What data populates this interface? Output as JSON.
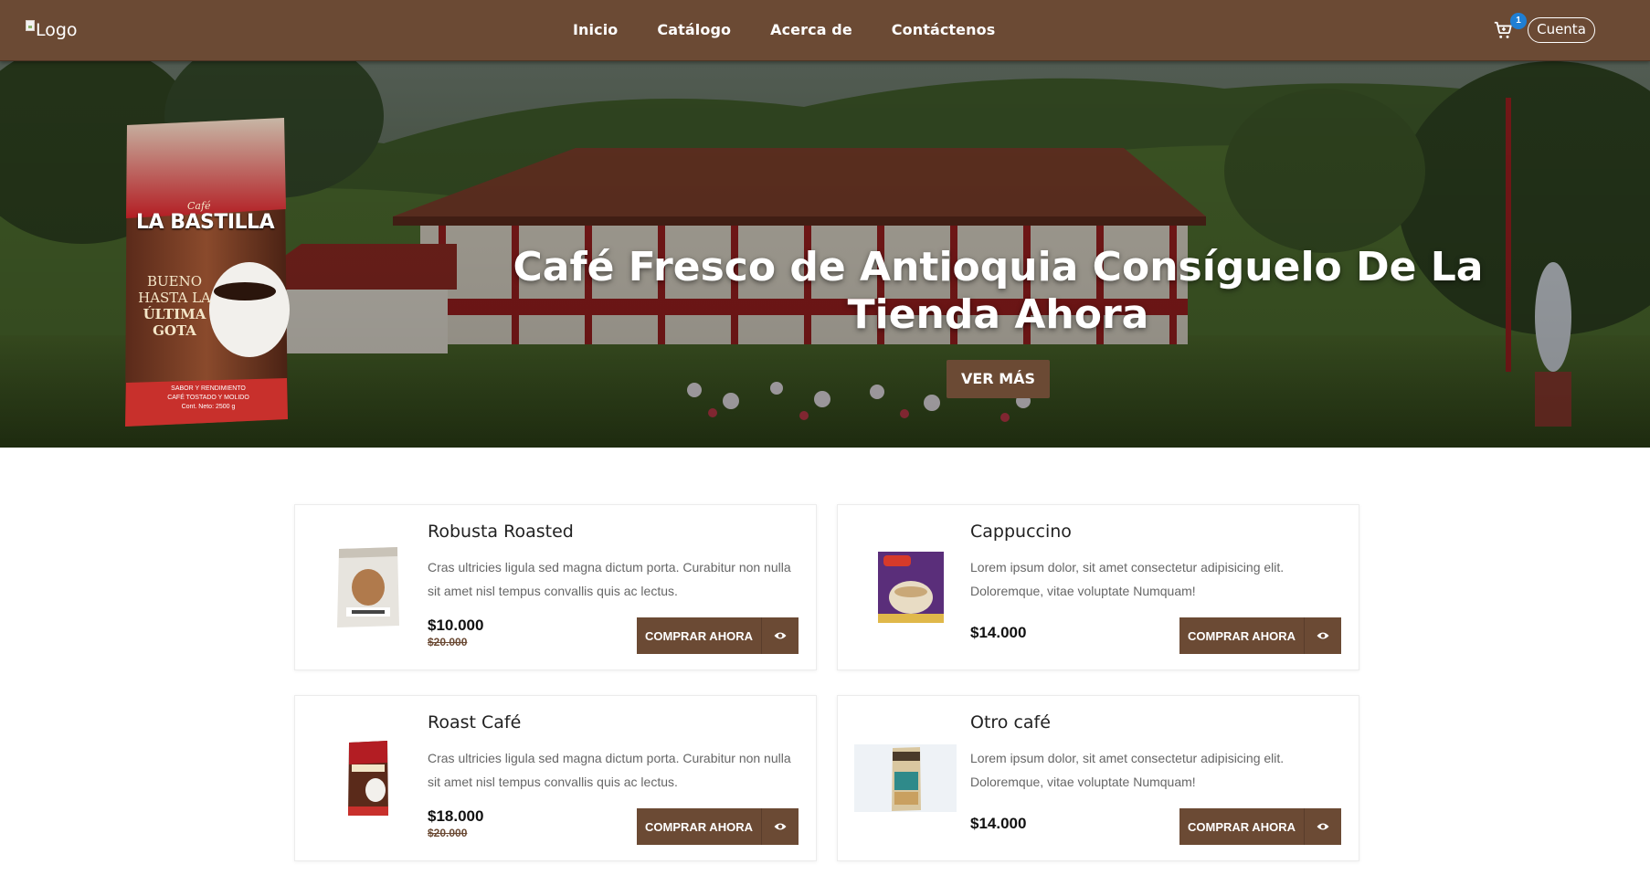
{
  "navbar": {
    "logo_alt": "Logo",
    "links": [
      "Inicio",
      "Catálogo",
      "Acerca de",
      "Contáctenos"
    ],
    "cart_count": "1",
    "account_label": "Cuenta"
  },
  "hero": {
    "title": "Café Fresco de Antioquia Consíguelo De La Tienda Ahora",
    "button": "VER MÁS",
    "package": {
      "brand_small": "Café",
      "brand": "LA BASTILLA",
      "slogan": [
        "BUENO",
        "HASTA LA",
        "ÚLTIMA",
        "GOTA"
      ],
      "footer": [
        "SABOR Y RENDIMIENTO",
        "CAFÉ TOSTADO Y MOLIDO",
        "Cont. Neto: 2500 g"
      ]
    }
  },
  "products": [
    {
      "name": "Robusta Roasted",
      "description": "Cras ultricies ligula sed magna dictum porta. Curabitur non nulla sit amet nisl tempus convallis quis ac lectus.",
      "price": "$10.000",
      "old_price": "$20.000",
      "button": "COMPRAR AHORA"
    },
    {
      "name": "Cappuccino",
      "description": "Lorem ipsum dolor, sit amet consectetur adipisicing elit. Doloremque, vitae voluptate Numquam!",
      "price": "$14.000",
      "old_price": "",
      "button": "COMPRAR AHORA"
    },
    {
      "name": "Roast Café",
      "description": "Cras ultricies ligula sed magna dictum porta. Curabitur non nulla sit amet nisl tempus convallis quis ac lectus.",
      "price": "$18.000",
      "old_price": "$20.000",
      "button": "COMPRAR AHORA"
    },
    {
      "name": "Otro café",
      "description": "Lorem ipsum dolor, sit amet consectetur adipisicing elit. Doloremque, vitae voluptate Numquam!",
      "price": "$14.000",
      "old_price": "",
      "button": "COMPRAR AHORA"
    }
  ],
  "colors": {
    "brand_brown": "#6b4a34",
    "badge_blue": "#1f7fd4"
  },
  "icons": [
    "cart-icon",
    "eye-icon"
  ]
}
